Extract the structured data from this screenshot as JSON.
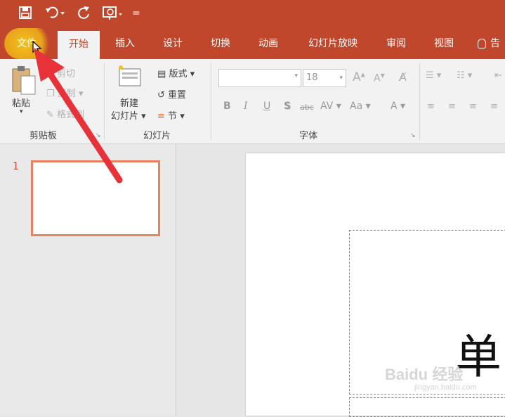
{
  "quick_access": {
    "customize_glyph": "="
  },
  "tabs": [
    {
      "label": "文件"
    },
    {
      "label": "开始"
    },
    {
      "label": "插入"
    },
    {
      "label": "设计"
    },
    {
      "label": "切换"
    },
    {
      "label": "动画"
    },
    {
      "label": "幻灯片放映"
    },
    {
      "label": "审阅"
    },
    {
      "label": "视图"
    },
    {
      "label": "告"
    }
  ],
  "ribbon": {
    "clipboard": {
      "paste": "粘贴",
      "cut": "剪切",
      "copy": "复制",
      "format_painter": "格式刷",
      "group": "剪贴板"
    },
    "slides": {
      "new_slide_1": "新建",
      "new_slide_2": "幻灯片",
      "layout": "版式",
      "reset": "重置",
      "section": "节",
      "group": "幻灯片"
    },
    "font": {
      "font_name": "",
      "font_size": "18",
      "group": "字体",
      "grow": "A",
      "shrink": "A",
      "bold": "B",
      "italic": "I",
      "underline": "U",
      "shadow": "S",
      "strike": "abc",
      "spacing": "AV",
      "case": "Aa",
      "color": "A"
    }
  },
  "thumbnail": {
    "number": "1"
  },
  "slide": {
    "char": "单"
  },
  "watermark": {
    "brand": "Baidu 经验",
    "url": "jingyan.baidu.com"
  },
  "colors": {
    "accent": "#c0472b",
    "arrow": "#e8323a",
    "highlight": "#f3c21a"
  }
}
